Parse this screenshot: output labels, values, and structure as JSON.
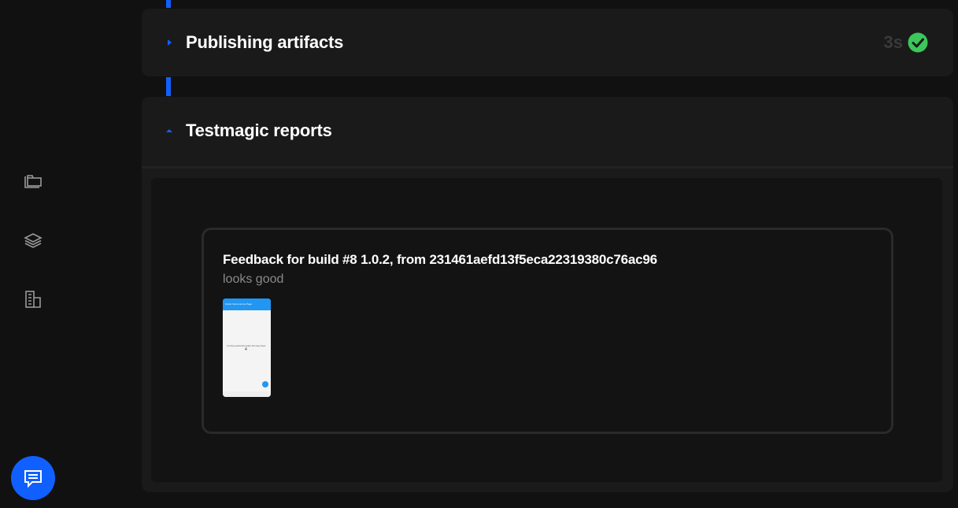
{
  "sidebar": {
    "icons": [
      "folders-icon",
      "layers-icon",
      "buildings-icon"
    ],
    "chat_icon": "chat-icon"
  },
  "steps": [
    {
      "title": "Publishing artifacts",
      "duration": "3s",
      "status": "success",
      "expanded": false
    },
    {
      "title": "Testmagic reports",
      "expanded": true
    }
  ],
  "report": {
    "feedback_title": "Feedback for build #8 1.0.2, from 231461aefd13f5eca22319380c76ac96",
    "comment": "looks good",
    "screenshot": {
      "app_bar": "Flutter Demo Home Page",
      "body_text": "You have pushed the button this many times:",
      "count": "4"
    }
  },
  "colors": {
    "accent": "#1060ff",
    "success": "#3cc75a",
    "background": "#111111",
    "card": "#1a1a1a"
  }
}
